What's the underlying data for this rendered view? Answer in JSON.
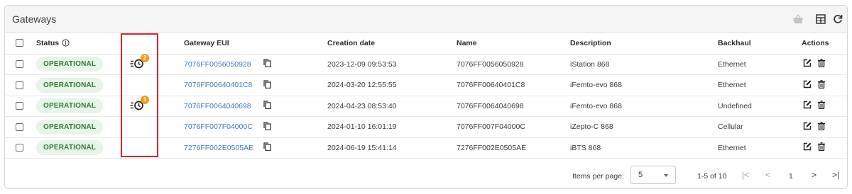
{
  "panel": {
    "title": "Gateways"
  },
  "header_icons": {
    "basket": "basket-icon",
    "columns": "columns-icon",
    "refresh": "refresh-icon"
  },
  "columns": {
    "status": "Status",
    "gateway_eui": "Gateway EUI",
    "creation_date": "Creation date",
    "name": "Name",
    "description": "Description",
    "backhaul": "Backhaul",
    "actions": "Actions"
  },
  "rows": [
    {
      "status": "OPERATIONAL",
      "alert_count": "2",
      "eui": "7076FF0056050928",
      "created": "2023-12-09 09:53:53",
      "name": "7076FF0056050928",
      "description": "iStation 868",
      "backhaul": "Ethernet"
    },
    {
      "status": "OPERATIONAL",
      "alert_count": "",
      "eui": "7076FF00640401C8",
      "created": "2024-03-20 12:55:55",
      "name": "7076FF00640401C8",
      "description": "iFemto-evo 868",
      "backhaul": "Ethernet"
    },
    {
      "status": "OPERATIONAL",
      "alert_count": "1",
      "eui": "7076FF0064040698",
      "created": "2024-04-23 08:53:40",
      "name": "7076FF0064040698",
      "description": "iFemto-evo 868",
      "backhaul": "Undefined"
    },
    {
      "status": "OPERATIONAL",
      "alert_count": "",
      "eui": "7076FF007F04000C",
      "created": "2024-01-10 16:01:19",
      "name": "7076FF007F04000C",
      "description": "iZepto-C 868",
      "backhaul": "Cellular"
    },
    {
      "status": "OPERATIONAL",
      "alert_count": "",
      "eui": "7276FF002E0505AE",
      "created": "2024-06-19 15:41:14",
      "name": "7276FF002E0505AE",
      "description": "iBTS 868",
      "backhaul": "Ethernet"
    }
  ],
  "footer": {
    "items_per_page_label": "Items per page:",
    "items_per_page_value": "5",
    "range": "1-5 of 10",
    "current_page": "1",
    "first": "|<",
    "prev": "<",
    "next": ">",
    "last": ">|"
  },
  "colors": {
    "status_bg": "#e7f4e8",
    "status_text": "#2e7d32",
    "link": "#3d7ab8",
    "badge": "#f39a1e",
    "highlight": "#e0202a"
  }
}
